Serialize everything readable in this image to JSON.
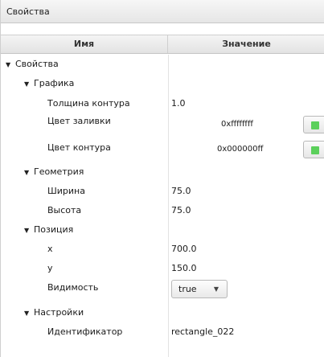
{
  "panel": {
    "title": "Свойства"
  },
  "columns": {
    "name": "Имя",
    "value": "Значение"
  },
  "rows": {
    "root": {
      "label": "Свойства"
    },
    "graphics": {
      "label": "Графика"
    },
    "stroke_width": {
      "label": "Толщина контура",
      "value": "1.0"
    },
    "fill_color": {
      "label": "Цвет заливки",
      "value": "0xffffffff",
      "swatch": "#5bd05b"
    },
    "stroke_color": {
      "label": "Цвет контура",
      "value": "0x000000ff",
      "swatch": "#5bd05b"
    },
    "geometry": {
      "label": "Геометрия"
    },
    "width": {
      "label": "Ширина",
      "value": "75.0"
    },
    "height": {
      "label": "Высота",
      "value": "75.0"
    },
    "position": {
      "label": "Позиция"
    },
    "x": {
      "label": "x",
      "value": "700.0"
    },
    "y": {
      "label": "y",
      "value": "150.0"
    },
    "visibility": {
      "label": "Видимость",
      "value": "true"
    },
    "settings": {
      "label": "Настройки"
    },
    "identifier": {
      "label": "Идентификатор",
      "value": "rectangle_022"
    }
  }
}
